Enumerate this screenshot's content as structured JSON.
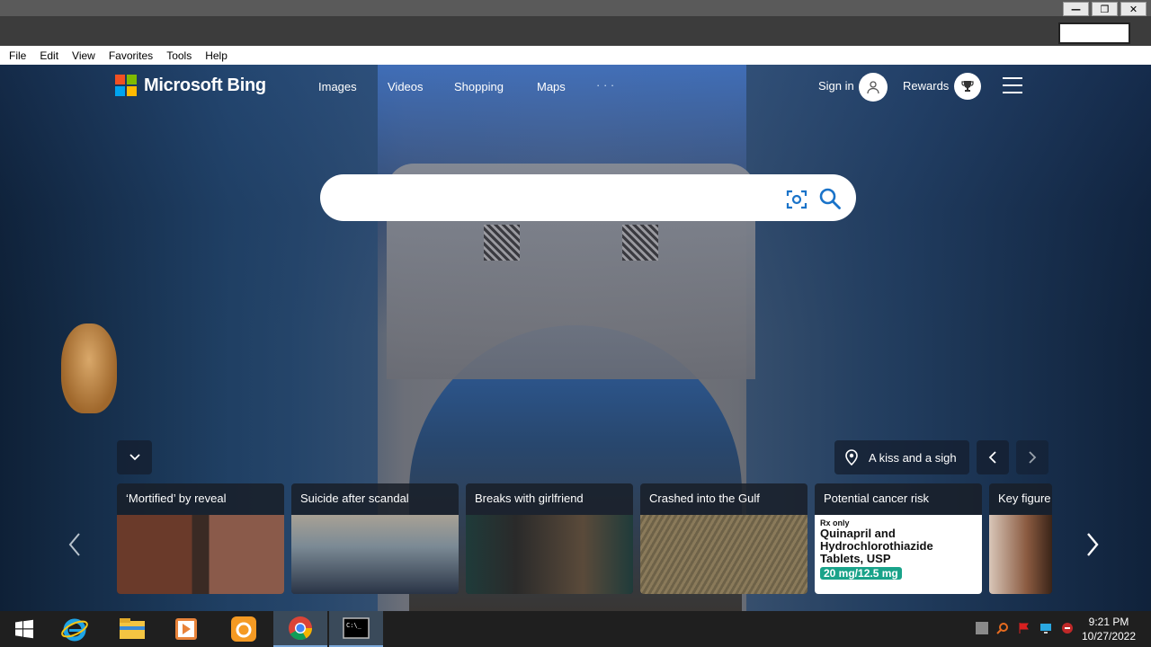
{
  "window": {
    "minimize_label": "—",
    "maximize_label": "❐",
    "close_label": "✕"
  },
  "menu": [
    "File",
    "Edit",
    "View",
    "Favorites",
    "Tools",
    "Help"
  ],
  "bing": {
    "logo_text": "Microsoft Bing",
    "nav": [
      "Images",
      "Videos",
      "Shopping",
      "Maps",
      "· · ·"
    ],
    "sign_in": "Sign in",
    "rewards": "Rewards",
    "search_placeholder": "",
    "location_label": "A kiss and a sigh",
    "accent_colors": {
      "ms_red": "#f25022",
      "ms_green": "#7fba00",
      "ms_blue": "#00a4ef",
      "ms_yellow": "#ffb900",
      "icon_blue": "#1a73c9"
    }
  },
  "news": [
    {
      "title": "‘Mortified’ by reveal"
    },
    {
      "title": "Suicide after scandal"
    },
    {
      "title": "Breaks with girlfriend"
    },
    {
      "title": "Crashed into the Gulf"
    },
    {
      "title": "Potential cancer risk"
    },
    {
      "title": "Key figure"
    }
  ],
  "thumb_text": {
    "rx": "Rx only",
    "drug": "Quinapril and Hydrochlorothiazide Tablets, USP",
    "dose": "20 mg/12.5 mg"
  },
  "taskbar": {
    "apps": [
      "windows-start",
      "internet-explorer",
      "file-explorer",
      "media-player",
      "uc-browser",
      "chrome",
      "command-prompt"
    ],
    "time": "9:21 PM",
    "date": "10/27/2022"
  }
}
